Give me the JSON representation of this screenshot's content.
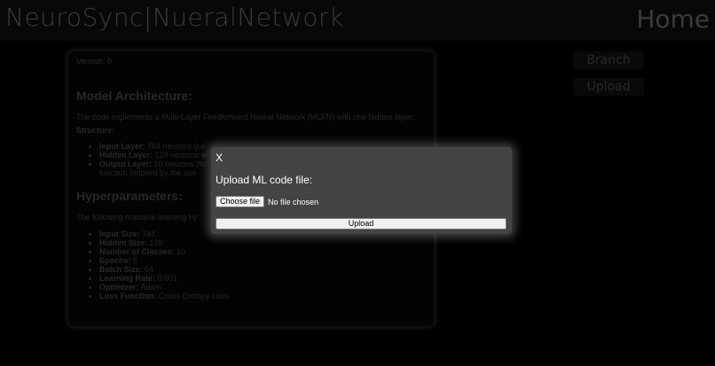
{
  "header": {
    "brand": "NeuroSync|NueralNetwork",
    "home_label": "Home"
  },
  "card": {
    "version": "Version: 0",
    "model_heading": "Model Architecture:",
    "model_desc": "The code implements a Multi-Layer Feedforward Neural Network (MLFN) with one hidden layer.",
    "structure_label": "Structure:",
    "structure_items": [
      {
        "label": "Input Layer:",
        "value": " 784 neurons (co"
      },
      {
        "label": "Hidden Layer:",
        "value": " 128 neurons w"
      },
      {
        "label": "Output Layer:",
        "value": " 10 neurons (fo"
      }
    ],
    "structure_cont": "function (implied by the use",
    "params_heading": "Hyperparameters:",
    "params_desc": "The following machine learning hy",
    "params_items": [
      {
        "label": "Input Size:",
        "value": " 784"
      },
      {
        "label": "Hidden Size:",
        "value": " 128"
      },
      {
        "label": "Number of Classes:",
        "value": " 10"
      },
      {
        "label": "Epochs:",
        "value": " 5"
      },
      {
        "label": "Batch Size:",
        "value": " 64"
      },
      {
        "label": "Learning Rate:",
        "value": " 0.001"
      },
      {
        "label": "Optimizer:",
        "value": " Adam"
      },
      {
        "label": "Loss Function:",
        "value": " Cross-Entropy Loss"
      }
    ]
  },
  "side": {
    "branch_label": "Branch",
    "upload_label": "Upload"
  },
  "modal": {
    "close_label": "X",
    "title": "Upload ML code file:",
    "choose_label": "Choose file",
    "no_file": "No file chosen",
    "submit_label": "Upload"
  }
}
